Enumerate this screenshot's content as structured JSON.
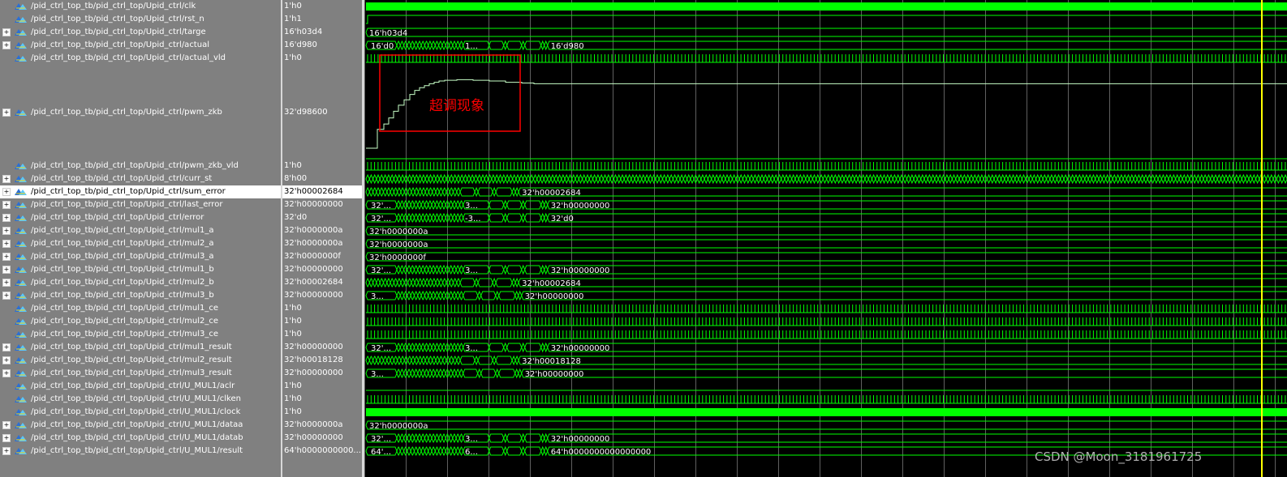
{
  "signals": [
    {
      "name": "/pid_ctrl_top_tb/pid_ctrl_top/Upid_ctrl/clk",
      "value": "1'h0",
      "bus": false,
      "kind": "clock",
      "h": 16
    },
    {
      "name": "/pid_ctrl_top_tb/pid_ctrl_top/Upid_ctrl/rst_n",
      "value": "1'h1",
      "bus": false,
      "kind": "high",
      "h": 16
    },
    {
      "name": "/pid_ctrl_top_tb/pid_ctrl_top/Upid_ctrl/targe",
      "value": "16'h03d4",
      "bus": true,
      "kind": "bus",
      "label": "16'h03d4",
      "h": 16
    },
    {
      "name": "/pid_ctrl_top_tb/pid_ctrl_top/Upid_ctrl/actual",
      "value": "16'd980",
      "bus": true,
      "kind": "bus",
      "first": "16'd0",
      "mid": "1...",
      "label": "16'd980",
      "h": 16
    },
    {
      "name": "/pid_ctrl_top_tb/pid_ctrl_top/Upid_ctrl/actual_vld",
      "value": "1'h0",
      "bus": false,
      "kind": "pulse",
      "h": 16
    },
    {
      "name": "/pid_ctrl_top_tb/pid_ctrl_top/Upid_ctrl/pwm_zkb",
      "value": "32'd98600",
      "bus": true,
      "kind": "analog",
      "h": 117
    },
    {
      "name": "/pid_ctrl_top_tb/pid_ctrl_top/Upid_ctrl/pwm_zkb_vld",
      "value": "1'h0",
      "bus": false,
      "kind": "pulse",
      "h": 16
    },
    {
      "name": "/pid_ctrl_top_tb/pid_ctrl_top/Upid_ctrl/curr_st",
      "value": "8'h00",
      "bus": true,
      "kind": "dense",
      "h": 16
    },
    {
      "name": "/pid_ctrl_top_tb/pid_ctrl_top/Upid_ctrl/sum_error",
      "value": "32'h00002684",
      "bus": true,
      "kind": "bus",
      "first": "",
      "mid": "",
      "label": "32'h00002684",
      "selected": true,
      "h": 16
    },
    {
      "name": "/pid_ctrl_top_tb/pid_ctrl_top/Upid_ctrl/last_error",
      "value": "32'h00000000",
      "bus": true,
      "kind": "bus",
      "first": "32'...",
      "mid": "3...",
      "label": "32'h00000000",
      "h": 16
    },
    {
      "name": "/pid_ctrl_top_tb/pid_ctrl_top/Upid_ctrl/error",
      "value": "32'd0",
      "bus": true,
      "kind": "bus",
      "first": "32'...",
      "mid": "-3...",
      "label": "32'd0",
      "h": 16
    },
    {
      "name": "/pid_ctrl_top_tb/pid_ctrl_top/Upid_ctrl/mul1_a",
      "value": "32'h0000000a",
      "bus": true,
      "kind": "bus",
      "label": "32'h0000000a",
      "h": 16
    },
    {
      "name": "/pid_ctrl_top_tb/pid_ctrl_top/Upid_ctrl/mul2_a",
      "value": "32'h0000000a",
      "bus": true,
      "kind": "bus",
      "label": "32'h0000000a",
      "h": 16
    },
    {
      "name": "/pid_ctrl_top_tb/pid_ctrl_top/Upid_ctrl/mul3_a",
      "value": "32'h0000000f",
      "bus": true,
      "kind": "bus",
      "label": "32'h0000000f",
      "h": 16
    },
    {
      "name": "/pid_ctrl_top_tb/pid_ctrl_top/Upid_ctrl/mul1_b",
      "value": "32'h00000000",
      "bus": true,
      "kind": "bus",
      "first": "32'...",
      "mid": "3...",
      "label": "32'h00000000",
      "h": 16
    },
    {
      "name": "/pid_ctrl_top_tb/pid_ctrl_top/Upid_ctrl/mul2_b",
      "value": "32'h00002684",
      "bus": true,
      "kind": "bus",
      "first": "",
      "mid": "",
      "label": "32'h00002684",
      "h": 16
    },
    {
      "name": "/pid_ctrl_top_tb/pid_ctrl_top/Upid_ctrl/mul3_b",
      "value": "32'h00000000",
      "bus": true,
      "kind": "bus",
      "first": "3...",
      "mid": "",
      "label": "32'h00000000",
      "h": 16
    },
    {
      "name": "/pid_ctrl_top_tb/pid_ctrl_top/Upid_ctrl/mul1_ce",
      "value": "1'h0",
      "bus": false,
      "kind": "pulse",
      "h": 16
    },
    {
      "name": "/pid_ctrl_top_tb/pid_ctrl_top/Upid_ctrl/mul2_ce",
      "value": "1'h0",
      "bus": false,
      "kind": "pulse",
      "h": 16
    },
    {
      "name": "/pid_ctrl_top_tb/pid_ctrl_top/Upid_ctrl/mul3_ce",
      "value": "1'h0",
      "bus": false,
      "kind": "pulse",
      "h": 16
    },
    {
      "name": "/pid_ctrl_top_tb/pid_ctrl_top/Upid_ctrl/mul1_result",
      "value": "32'h00000000",
      "bus": true,
      "kind": "bus",
      "first": "32'...",
      "mid": "3...",
      "label": "32'h00000000",
      "h": 16
    },
    {
      "name": "/pid_ctrl_top_tb/pid_ctrl_top/Upid_ctrl/mul2_result",
      "value": "32'h00018128",
      "bus": true,
      "kind": "bus",
      "first": "",
      "mid": "",
      "label": "32'h00018128",
      "h": 16
    },
    {
      "name": "/pid_ctrl_top_tb/pid_ctrl_top/Upid_ctrl/mul3_result",
      "value": "32'h00000000",
      "bus": true,
      "kind": "bus",
      "first": "3...",
      "mid": "",
      "label": "32'h00000000",
      "h": 16
    },
    {
      "name": "/pid_ctrl_top_tb/pid_ctrl_top/Upid_ctrl/U_MUL1/aclr",
      "value": "1'h0",
      "bus": false,
      "kind": "low",
      "h": 16
    },
    {
      "name": "/pid_ctrl_top_tb/pid_ctrl_top/Upid_ctrl/U_MUL1/clken",
      "value": "1'h0",
      "bus": false,
      "kind": "pulse",
      "h": 16
    },
    {
      "name": "/pid_ctrl_top_tb/pid_ctrl_top/Upid_ctrl/U_MUL1/clock",
      "value": "1'h0",
      "bus": false,
      "kind": "clock",
      "h": 16
    },
    {
      "name": "/pid_ctrl_top_tb/pid_ctrl_top/Upid_ctrl/U_MUL1/dataa",
      "value": "32'h0000000a",
      "bus": true,
      "kind": "bus",
      "label": "32'h0000000a",
      "h": 16
    },
    {
      "name": "/pid_ctrl_top_tb/pid_ctrl_top/Upid_ctrl/U_MUL1/datab",
      "value": "32'h00000000",
      "bus": true,
      "kind": "bus",
      "first": "32'...",
      "mid": "3...",
      "label": "32'h00000000",
      "h": 16
    },
    {
      "name": "/pid_ctrl_top_tb/pid_ctrl_top/Upid_ctrl/U_MUL1/result",
      "value": "64'h0000000000...",
      "bus": true,
      "kind": "bus",
      "first": "64'...",
      "mid": "6...",
      "label": "64'h0000000000000000",
      "h": 16
    }
  ],
  "annotation": {
    "text": "超调现象",
    "color": "#ff0000"
  },
  "watermark": {
    "text": "CSDN @Moon_3181961725"
  },
  "colors": {
    "wave": "#00ff00",
    "grid": "#606060",
    "cursor": "#ffff00",
    "background": "#000000"
  }
}
